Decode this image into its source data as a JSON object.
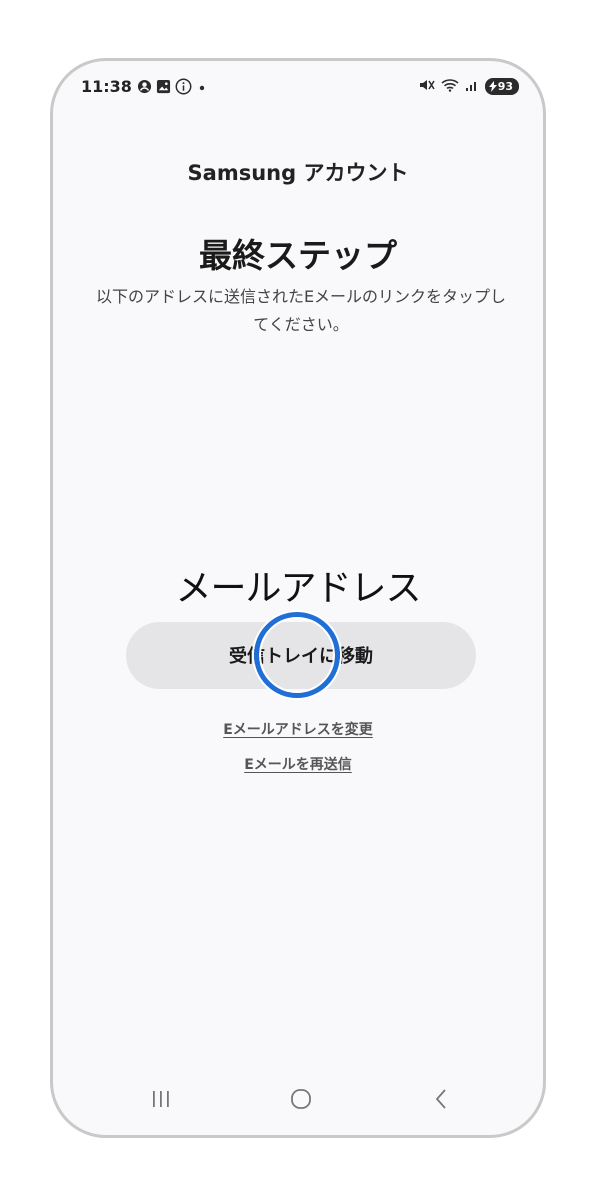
{
  "status_bar": {
    "time": "11:38",
    "battery": "93",
    "left_icons": [
      "account-circle-icon",
      "image-icon",
      "info-icon",
      "dot-icon"
    ],
    "right_icons": [
      "mute-icon",
      "wifi-icon",
      "signal-icon",
      "battery-icon"
    ]
  },
  "header": {
    "app_title": "Samsung アカウント"
  },
  "main": {
    "heading": "最終ステップ",
    "instruction": "以下のアドレスに送信されたEメールのリンクをタップしてください。",
    "email_label": "メールアドレス",
    "inbox_button_label": "受信トレイに移動",
    "change_email_link": "Eメールアドレスを変更",
    "resend_email_link": "Eメールを再送信"
  },
  "nav_bar": {
    "icons": [
      "recents-icon",
      "home-icon",
      "back-icon"
    ]
  },
  "colors": {
    "tap_indicator": "#1f6fd6",
    "button_bg": "#e5e5e7",
    "screen_bg": "#f9f9fb"
  }
}
